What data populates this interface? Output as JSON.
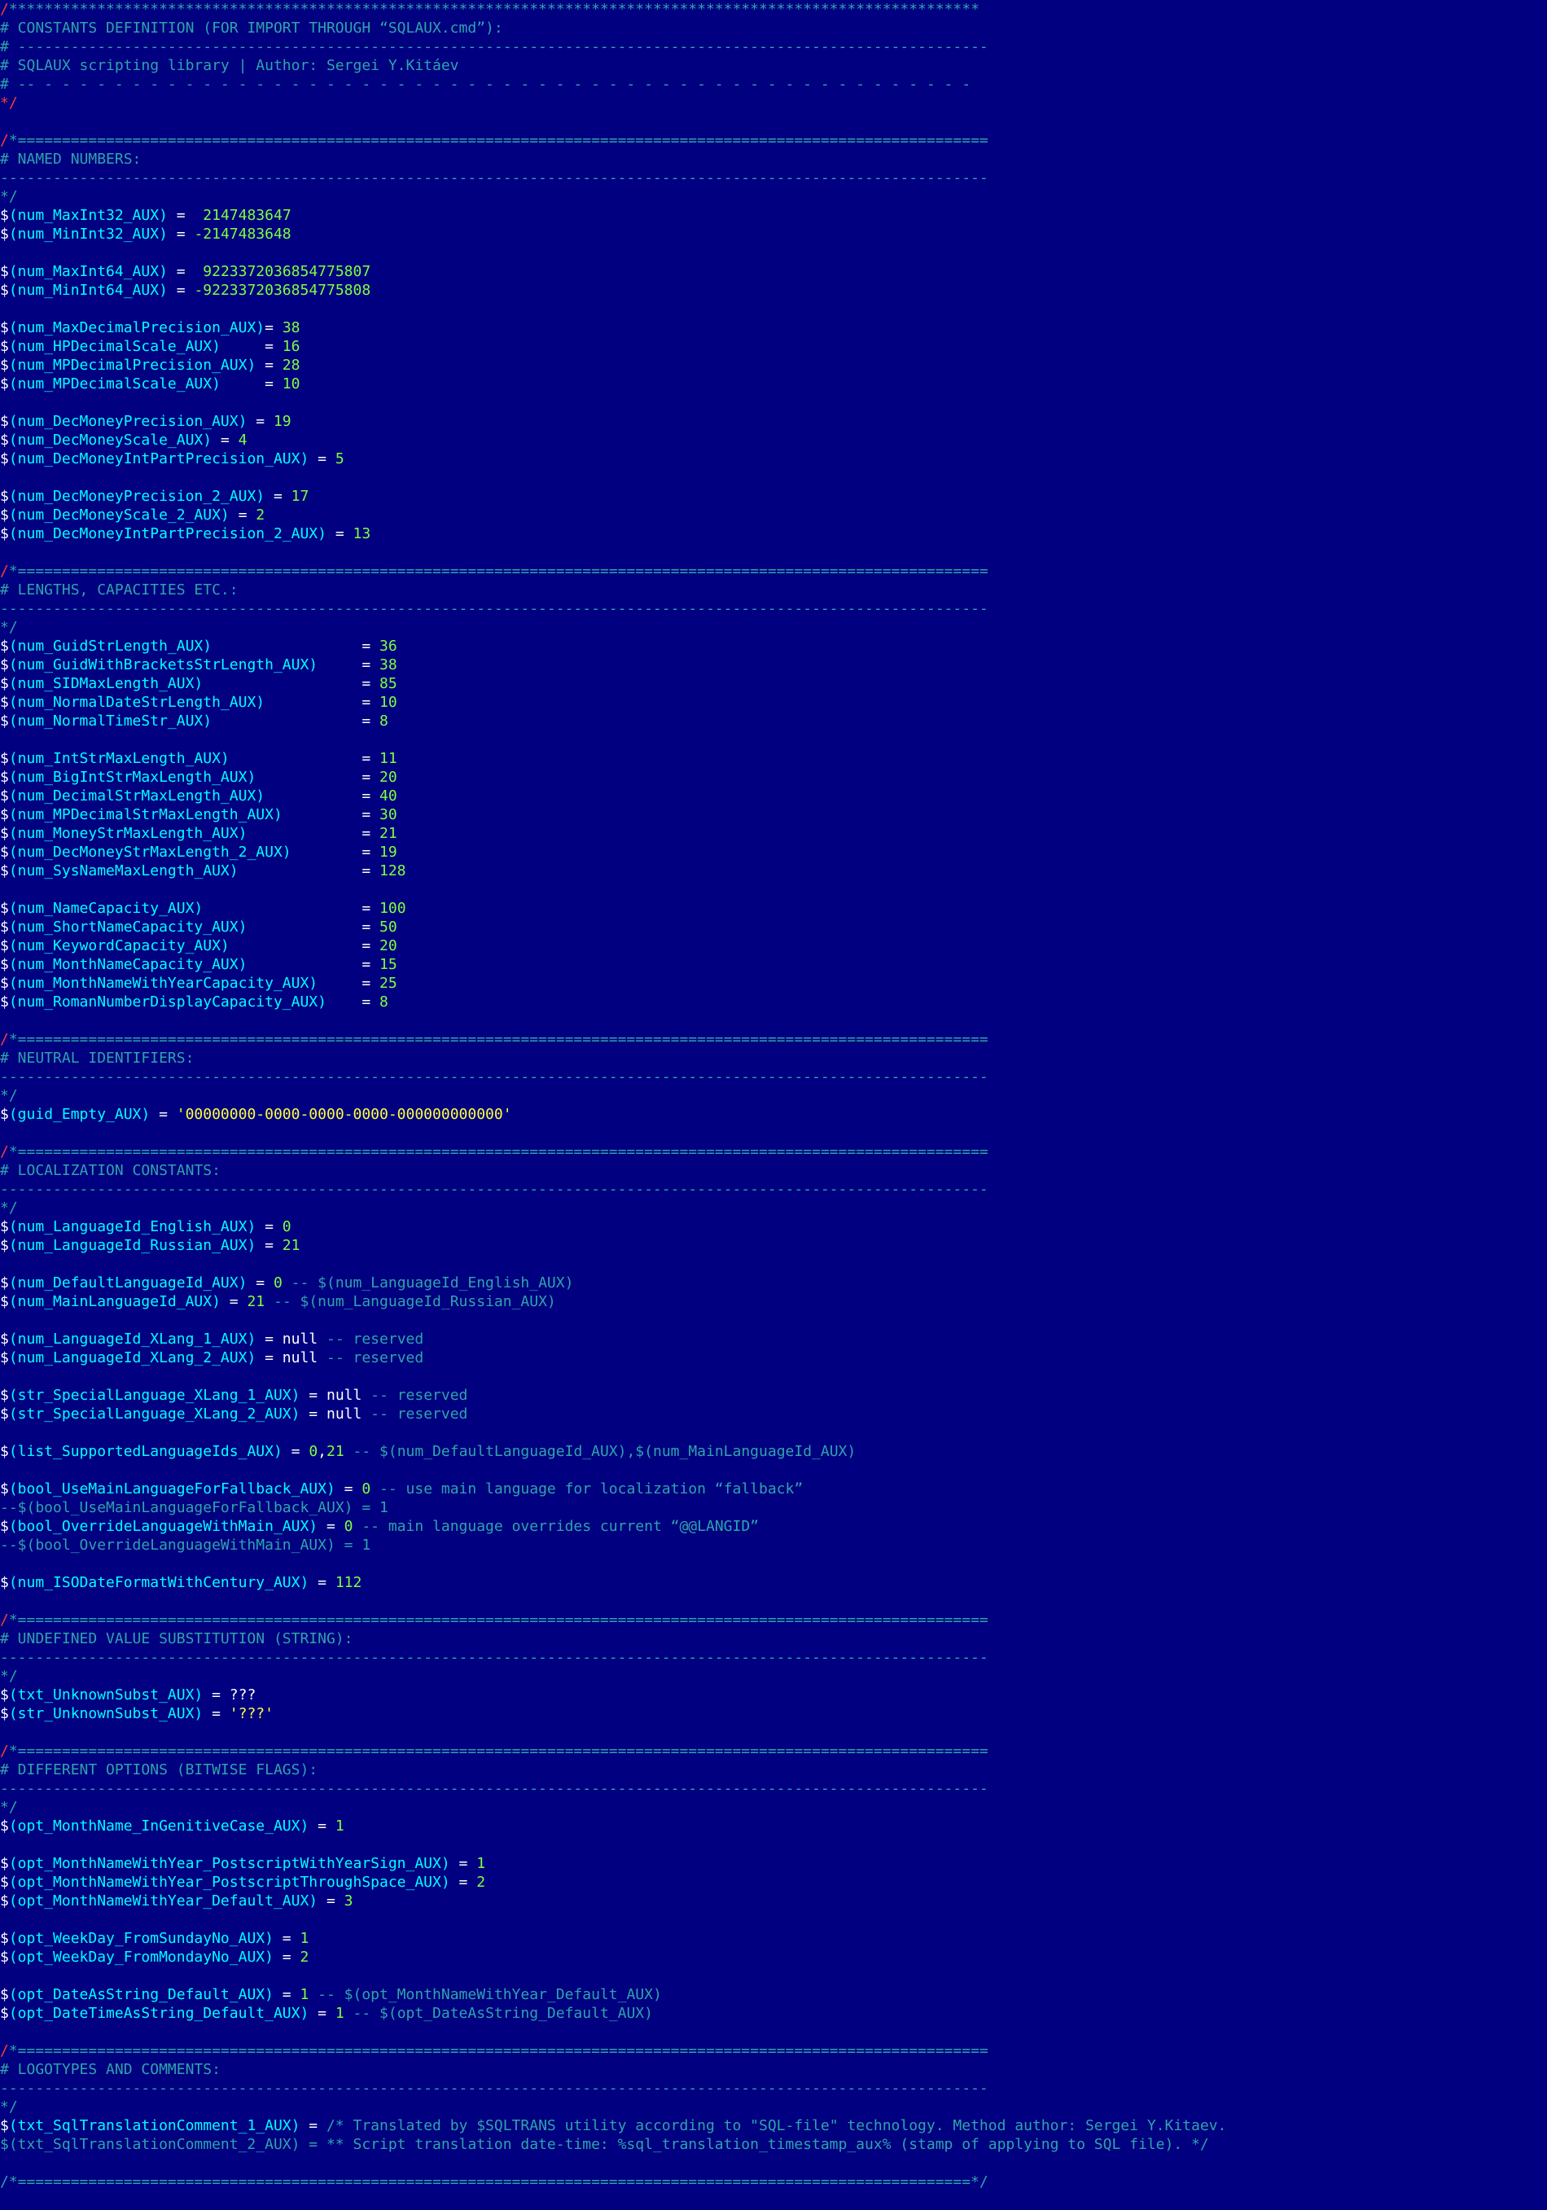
{
  "colors": {
    "background": "#000080",
    "comment": "#2fa3ac",
    "comment_marker_red": "#ff3b3b",
    "variable": "#00ffff",
    "number": "#7fff3f",
    "string": "#ffff3f",
    "plain": "#ffffff"
  },
  "lines": [
    [
      [
        "red",
        "/"
      ],
      [
        "com",
        "**************************************************************************************************************"
      ]
    ],
    [
      [
        "com",
        "# CONSTANTS DEFINITION (FOR IMPORT THROUGH “SQLAUX.cmd”):"
      ]
    ],
    [
      [
        "com",
        "# --------------------------------------------------------------------------------------------------------------"
      ]
    ],
    [
      [
        "com",
        "# SQLAUX scripting library | Author: Sergei Y.Kitáev"
      ]
    ],
    [
      [
        "com",
        "# -- - - - - - - - - - - - - - - - - - - - - - - - - - - - - - - - - - - - - - - - - - - - - - - - - - - - - -"
      ]
    ],
    [
      [
        "red",
        "*/"
      ]
    ],
    [],
    [
      [
        "red",
        "/"
      ],
      [
        "com",
        "*=============================================================================================================="
      ]
    ],
    [
      [
        "com",
        "# NAMED NUMBERS:"
      ]
    ],
    [
      [
        "com",
        "----------------------------------------------------------------------------------------------------------------"
      ]
    ],
    [
      [
        "com",
        "*/"
      ]
    ],
    [
      [
        "dollar",
        "$"
      ],
      [
        "var",
        "(num_MaxInt32_AUX)"
      ],
      [
        "op",
        " =  "
      ],
      [
        "num",
        "2147483647"
      ]
    ],
    [
      [
        "dollar",
        "$"
      ],
      [
        "var",
        "(num_MinInt32_AUX)"
      ],
      [
        "op",
        " = "
      ],
      [
        "num",
        "-2147483648"
      ]
    ],
    [],
    [
      [
        "dollar",
        "$"
      ],
      [
        "var",
        "(num_MaxInt64_AUX)"
      ],
      [
        "op",
        " =  "
      ],
      [
        "num",
        "9223372036854775807"
      ]
    ],
    [
      [
        "dollar",
        "$"
      ],
      [
        "var",
        "(num_MinInt64_AUX)"
      ],
      [
        "op",
        " = "
      ],
      [
        "num",
        "-9223372036854775808"
      ]
    ],
    [],
    [
      [
        "dollar",
        "$"
      ],
      [
        "var",
        "(num_MaxDecimalPrecision_AUX)"
      ],
      [
        "op",
        "= "
      ],
      [
        "num",
        "38"
      ]
    ],
    [
      [
        "dollar",
        "$"
      ],
      [
        "var",
        "(num_HPDecimalScale_AUX)"
      ],
      [
        "op",
        "     = "
      ],
      [
        "num",
        "16"
      ]
    ],
    [
      [
        "dollar",
        "$"
      ],
      [
        "var",
        "(num_MPDecimalPrecision_AUX)"
      ],
      [
        "op",
        " = "
      ],
      [
        "num",
        "28"
      ]
    ],
    [
      [
        "dollar",
        "$"
      ],
      [
        "var",
        "(num_MPDecimalScale_AUX)"
      ],
      [
        "op",
        "     = "
      ],
      [
        "num",
        "10"
      ]
    ],
    [],
    [
      [
        "dollar",
        "$"
      ],
      [
        "var",
        "(num_DecMoneyPrecision_AUX)"
      ],
      [
        "op",
        " = "
      ],
      [
        "num",
        "19"
      ]
    ],
    [
      [
        "dollar",
        "$"
      ],
      [
        "var",
        "(num_DecMoneyScale_AUX)"
      ],
      [
        "op",
        " = "
      ],
      [
        "num",
        "4"
      ]
    ],
    [
      [
        "dollar",
        "$"
      ],
      [
        "var",
        "(num_DecMoneyIntPartPrecision_AUX)"
      ],
      [
        "op",
        " = "
      ],
      [
        "num",
        "5"
      ]
    ],
    [],
    [
      [
        "dollar",
        "$"
      ],
      [
        "var",
        "(num_DecMoneyPrecision_2_AUX)"
      ],
      [
        "op",
        " = "
      ],
      [
        "num",
        "17"
      ]
    ],
    [
      [
        "dollar",
        "$"
      ],
      [
        "var",
        "(num_DecMoneyScale_2_AUX)"
      ],
      [
        "op",
        " = "
      ],
      [
        "num",
        "2"
      ]
    ],
    [
      [
        "dollar",
        "$"
      ],
      [
        "var",
        "(num_DecMoneyIntPartPrecision_2_AUX)"
      ],
      [
        "op",
        " = "
      ],
      [
        "num",
        "13"
      ]
    ],
    [],
    [
      [
        "red",
        "/"
      ],
      [
        "com",
        "*=============================================================================================================="
      ]
    ],
    [
      [
        "com",
        "# LENGTHS, CAPACITIES ETC.:"
      ]
    ],
    [
      [
        "com",
        "----------------------------------------------------------------------------------------------------------------"
      ]
    ],
    [
      [
        "com",
        "*/"
      ]
    ],
    [
      [
        "dollar",
        "$"
      ],
      [
        "var",
        "(num_GuidStrLength_AUX)"
      ],
      [
        "op",
        "                 = "
      ],
      [
        "num",
        "36"
      ]
    ],
    [
      [
        "dollar",
        "$"
      ],
      [
        "var",
        "(num_GuidWithBracketsStrLength_AUX)"
      ],
      [
        "op",
        "     = "
      ],
      [
        "num",
        "38"
      ]
    ],
    [
      [
        "dollar",
        "$"
      ],
      [
        "var",
        "(num_SIDMaxLength_AUX)"
      ],
      [
        "op",
        "                  = "
      ],
      [
        "num",
        "85"
      ]
    ],
    [
      [
        "dollar",
        "$"
      ],
      [
        "var",
        "(num_NormalDateStrLength_AUX)"
      ],
      [
        "op",
        "           = "
      ],
      [
        "num",
        "10"
      ]
    ],
    [
      [
        "dollar",
        "$"
      ],
      [
        "var",
        "(num_NormalTimeStr_AUX)"
      ],
      [
        "op",
        "                 = "
      ],
      [
        "num",
        "8"
      ]
    ],
    [],
    [
      [
        "dollar",
        "$"
      ],
      [
        "var",
        "(num_IntStrMaxLength_AUX)"
      ],
      [
        "op",
        "               = "
      ],
      [
        "num",
        "11"
      ]
    ],
    [
      [
        "dollar",
        "$"
      ],
      [
        "var",
        "(num_BigIntStrMaxLength_AUX)"
      ],
      [
        "op",
        "            = "
      ],
      [
        "num",
        "20"
      ]
    ],
    [
      [
        "dollar",
        "$"
      ],
      [
        "var",
        "(num_DecimalStrMaxLength_AUX)"
      ],
      [
        "op",
        "           = "
      ],
      [
        "num",
        "40"
      ]
    ],
    [
      [
        "dollar",
        "$"
      ],
      [
        "var",
        "(num_MPDecimalStrMaxLength_AUX)"
      ],
      [
        "op",
        "         = "
      ],
      [
        "num",
        "30"
      ]
    ],
    [
      [
        "dollar",
        "$"
      ],
      [
        "var",
        "(num_MoneyStrMaxLength_AUX)"
      ],
      [
        "op",
        "             = "
      ],
      [
        "num",
        "21"
      ]
    ],
    [
      [
        "dollar",
        "$"
      ],
      [
        "var",
        "(num_DecMoneyStrMaxLength_2_AUX)"
      ],
      [
        "op",
        "        = "
      ],
      [
        "num",
        "19"
      ]
    ],
    [
      [
        "dollar",
        "$"
      ],
      [
        "var",
        "(num_SysNameMaxLength_AUX)"
      ],
      [
        "op",
        "              = "
      ],
      [
        "num",
        "128"
      ]
    ],
    [],
    [
      [
        "dollar",
        "$"
      ],
      [
        "var",
        "(num_NameCapacity_AUX)"
      ],
      [
        "op",
        "                  = "
      ],
      [
        "num",
        "100"
      ]
    ],
    [
      [
        "dollar",
        "$"
      ],
      [
        "var",
        "(num_ShortNameCapacity_AUX)"
      ],
      [
        "op",
        "             = "
      ],
      [
        "num",
        "50"
      ]
    ],
    [
      [
        "dollar",
        "$"
      ],
      [
        "var",
        "(num_KeywordCapacity_AUX)"
      ],
      [
        "op",
        "               = "
      ],
      [
        "num",
        "20"
      ]
    ],
    [
      [
        "dollar",
        "$"
      ],
      [
        "var",
        "(num_MonthNameCapacity_AUX)"
      ],
      [
        "op",
        "             = "
      ],
      [
        "num",
        "15"
      ]
    ],
    [
      [
        "dollar",
        "$"
      ],
      [
        "var",
        "(num_MonthNameWithYearCapacity_AUX)"
      ],
      [
        "op",
        "     = "
      ],
      [
        "num",
        "25"
      ]
    ],
    [
      [
        "dollar",
        "$"
      ],
      [
        "var",
        "(num_RomanNumberDisplayCapacity_AUX)"
      ],
      [
        "op",
        "    = "
      ],
      [
        "num",
        "8"
      ]
    ],
    [],
    [
      [
        "red",
        "/"
      ],
      [
        "com",
        "*=============================================================================================================="
      ]
    ],
    [
      [
        "com",
        "# NEUTRAL IDENTIFIERS:"
      ]
    ],
    [
      [
        "com",
        "----------------------------------------------------------------------------------------------------------------"
      ]
    ],
    [
      [
        "com",
        "*/"
      ]
    ],
    [
      [
        "dollar",
        "$"
      ],
      [
        "var",
        "(guid_Empty_AUX)"
      ],
      [
        "op",
        " = "
      ],
      [
        "str",
        "'00000000-0000-0000-0000-000000000000'"
      ]
    ],
    [],
    [
      [
        "red",
        "/"
      ],
      [
        "com",
        "*=============================================================================================================="
      ]
    ],
    [
      [
        "com",
        "# LOCALIZATION CONSTANTS:"
      ]
    ],
    [
      [
        "com",
        "----------------------------------------------------------------------------------------------------------------"
      ]
    ],
    [
      [
        "com",
        "*/"
      ]
    ],
    [
      [
        "dollar",
        "$"
      ],
      [
        "var",
        "(num_LanguageId_English_AUX)"
      ],
      [
        "op",
        " = "
      ],
      [
        "num",
        "0"
      ]
    ],
    [
      [
        "dollar",
        "$"
      ],
      [
        "var",
        "(num_LanguageId_Russian_AUX)"
      ],
      [
        "op",
        " = "
      ],
      [
        "num",
        "21"
      ]
    ],
    [],
    [
      [
        "dollar",
        "$"
      ],
      [
        "var",
        "(num_DefaultLanguageId_AUX)"
      ],
      [
        "op",
        " = "
      ],
      [
        "num",
        "0"
      ],
      [
        "com",
        " -- $(num_LanguageId_English_AUX)"
      ]
    ],
    [
      [
        "dollar",
        "$"
      ],
      [
        "var",
        "(num_MainLanguageId_AUX)"
      ],
      [
        "op",
        " = "
      ],
      [
        "num",
        "21"
      ],
      [
        "com",
        " -- $(num_LanguageId_Russian_AUX)"
      ]
    ],
    [],
    [
      [
        "dollar",
        "$"
      ],
      [
        "var",
        "(num_LanguageId_XLang_1_AUX)"
      ],
      [
        "op",
        " = "
      ],
      [
        "null",
        "null"
      ],
      [
        "com",
        " -- reserved"
      ]
    ],
    [
      [
        "dollar",
        "$"
      ],
      [
        "var",
        "(num_LanguageId_XLang_2_AUX)"
      ],
      [
        "op",
        " = "
      ],
      [
        "null",
        "null"
      ],
      [
        "com",
        " -- reserved"
      ]
    ],
    [],
    [
      [
        "dollar",
        "$"
      ],
      [
        "var",
        "(str_SpecialLanguage_XLang_1_AUX)"
      ],
      [
        "op",
        " = "
      ],
      [
        "null",
        "null"
      ],
      [
        "com",
        " -- reserved"
      ]
    ],
    [
      [
        "dollar",
        "$"
      ],
      [
        "var",
        "(str_SpecialLanguage_XLang_2_AUX)"
      ],
      [
        "op",
        " = "
      ],
      [
        "null",
        "null"
      ],
      [
        "com",
        " -- reserved"
      ]
    ],
    [],
    [
      [
        "dollar",
        "$"
      ],
      [
        "var",
        "(list_SupportedLanguageIds_AUX)"
      ],
      [
        "op",
        " = "
      ],
      [
        "num",
        "0"
      ],
      [
        "op",
        ","
      ],
      [
        "num",
        "21"
      ],
      [
        "com",
        " -- $(num_DefaultLanguageId_AUX),$(num_MainLanguageId_AUX)"
      ]
    ],
    [],
    [
      [
        "dollar",
        "$"
      ],
      [
        "var",
        "(bool_UseMainLanguageForFallback_AUX)"
      ],
      [
        "op",
        " = "
      ],
      [
        "num",
        "0"
      ],
      [
        "com",
        " -- use main language for localization “fallback”"
      ]
    ],
    [
      [
        "com",
        "--$(bool_UseMainLanguageForFallback_AUX) = 1"
      ]
    ],
    [
      [
        "dollar",
        "$"
      ],
      [
        "var",
        "(bool_OverrideLanguageWithMain_AUX)"
      ],
      [
        "op",
        " = "
      ],
      [
        "num",
        "0"
      ],
      [
        "com",
        " -- main language overrides current “@@LANGID”"
      ]
    ],
    [
      [
        "com",
        "--$(bool_OverrideLanguageWithMain_AUX) = 1"
      ]
    ],
    [],
    [
      [
        "dollar",
        "$"
      ],
      [
        "var",
        "(num_ISODateFormatWithCentury_AUX)"
      ],
      [
        "op",
        " = "
      ],
      [
        "num",
        "112"
      ]
    ],
    [],
    [
      [
        "red",
        "/"
      ],
      [
        "com",
        "*=============================================================================================================="
      ]
    ],
    [
      [
        "com",
        "# UNDEFINED VALUE SUBSTITUTION (STRING):"
      ]
    ],
    [
      [
        "com",
        "----------------------------------------------------------------------------------------------------------------"
      ]
    ],
    [
      [
        "com",
        "*/"
      ]
    ],
    [
      [
        "dollar",
        "$"
      ],
      [
        "var",
        "(txt_UnknownSubst_AUX)"
      ],
      [
        "op",
        " = "
      ],
      [
        "raw",
        "???"
      ]
    ],
    [
      [
        "dollar",
        "$"
      ],
      [
        "var",
        "(str_UnknownSubst_AUX)"
      ],
      [
        "op",
        " = "
      ],
      [
        "str",
        "'???'"
      ]
    ],
    [],
    [
      [
        "red",
        "/"
      ],
      [
        "com",
        "*=============================================================================================================="
      ]
    ],
    [
      [
        "com",
        "# DIFFERENT OPTIONS (BITWISE FLAGS):"
      ]
    ],
    [
      [
        "com",
        "----------------------------------------------------------------------------------------------------------------"
      ]
    ],
    [
      [
        "com",
        "*/"
      ]
    ],
    [
      [
        "dollar",
        "$"
      ],
      [
        "var",
        "(opt_MonthName_InGenitiveCase_AUX)"
      ],
      [
        "op",
        " = "
      ],
      [
        "num",
        "1"
      ]
    ],
    [],
    [
      [
        "dollar",
        "$"
      ],
      [
        "var",
        "(opt_MonthNameWithYear_PostscriptWithYearSign_AUX)"
      ],
      [
        "op",
        " = "
      ],
      [
        "num",
        "1"
      ]
    ],
    [
      [
        "dollar",
        "$"
      ],
      [
        "var",
        "(opt_MonthNameWithYear_PostscriptThroughSpace_AUX)"
      ],
      [
        "op",
        " = "
      ],
      [
        "num",
        "2"
      ]
    ],
    [
      [
        "dollar",
        "$"
      ],
      [
        "var",
        "(opt_MonthNameWithYear_Default_AUX)"
      ],
      [
        "op",
        " = "
      ],
      [
        "num",
        "3"
      ]
    ],
    [],
    [
      [
        "dollar",
        "$"
      ],
      [
        "var",
        "(opt_WeekDay_FromSundayNo_AUX)"
      ],
      [
        "op",
        " = "
      ],
      [
        "num",
        "1"
      ]
    ],
    [
      [
        "dollar",
        "$"
      ],
      [
        "var",
        "(opt_WeekDay_FromMondayNo_AUX)"
      ],
      [
        "op",
        " = "
      ],
      [
        "num",
        "2"
      ]
    ],
    [],
    [
      [
        "dollar",
        "$"
      ],
      [
        "var",
        "(opt_DateAsString_Default_AUX)"
      ],
      [
        "op",
        " = "
      ],
      [
        "num",
        "1"
      ],
      [
        "com",
        " -- $(opt_MonthNameWithYear_Default_AUX)"
      ]
    ],
    [
      [
        "dollar",
        "$"
      ],
      [
        "var",
        "(opt_DateTimeAsString_Default_AUX)"
      ],
      [
        "op",
        " = "
      ],
      [
        "num",
        "1"
      ],
      [
        "com",
        " -- $(opt_DateAsString_Default_AUX)"
      ]
    ],
    [],
    [
      [
        "red",
        "/"
      ],
      [
        "com",
        "*=============================================================================================================="
      ]
    ],
    [
      [
        "com",
        "# LOGOTYPES AND COMMENTS:"
      ]
    ],
    [
      [
        "com",
        "----------------------------------------------------------------------------------------------------------------"
      ]
    ],
    [
      [
        "com",
        "*/"
      ]
    ],
    [
      [
        "dollar",
        "$"
      ],
      [
        "var",
        "(txt_SqlTranslationComment_1_AUX)"
      ],
      [
        "op",
        " = "
      ],
      [
        "com",
        "/* Translated by $SQLTRANS utility according to \"SQL-file\" technology. Method author: Sergei Y.Kitaev."
      ]
    ],
    [
      [
        "com",
        "$(txt_SqlTranslationComment_2_AUX) = ** Script translation date-time: %sql_translation_timestamp_aux% (stamp of applying to SQL file). */"
      ]
    ],
    [],
    [
      [
        "com",
        "/*============================================================================================================*/"
      ]
    ]
  ]
}
